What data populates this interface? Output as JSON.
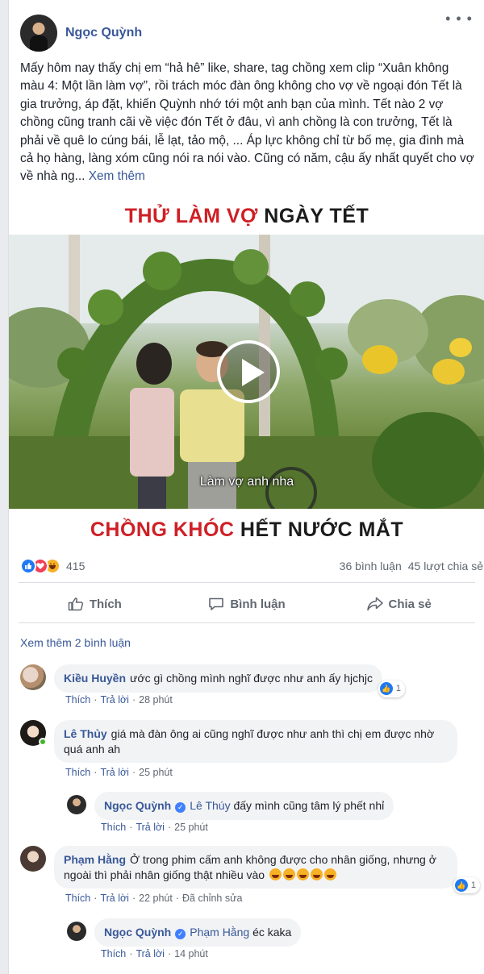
{
  "post": {
    "author": "Ngọc Quỳnh",
    "text": "Mấy hôm nay thấy chị em “hả hê” like, share, tag chồng xem clip “Xuân không màu 4: Một lần làm vợ”, rồi trách móc đàn ông không cho vợ về ngoại đón Tết là gia trưởng, áp đặt, khiến Quỳnh nhớ tới một anh bạn của mình. Tết nào 2 vợ chồng cũng tranh cãi về việc đón Tết ở đâu, vì anh chồng là con trưởng, Tết là phải về quê lo cúng bái, lễ lạt, tảo mộ, ... Áp lực không chỉ từ bố mẹ, gia đình mà cả họ hàng, làng xóm cũng nói ra nói vào. Cũng có năm, cậu ấy nhất quyết cho vợ về nhà ng...",
    "see_more": "Xem thêm"
  },
  "video": {
    "title_red": "THỬ LÀM VỢ",
    "title_dark": "NGÀY TẾT",
    "subtitle": "Làm vợ anh nha",
    "bottom_red": "CHỒNG KHÓC",
    "bottom_dark": "HẾT NƯỚC MẮT"
  },
  "stats": {
    "reactions": "415",
    "comments": "36 bình luận",
    "shares": "45 lượt chia sẻ"
  },
  "actions": {
    "like": "Thích",
    "comment": "Bình luận",
    "share": "Chia sẻ"
  },
  "view_more_comments": "Xem thêm 2 bình luận",
  "meta_labels": {
    "like": "Thích",
    "reply": "Trả lời",
    "edited": "Đã chỉnh sửa"
  },
  "comments": [
    {
      "name": "Kiều Huyền",
      "text": "ước gì chồng mình nghĩ được như anh ấy hjchjc",
      "time": "28 phút",
      "likes": "1"
    },
    {
      "name": "Lê Thủy",
      "text": "giá mà đàn ông ai cũng nghĩ được như anh thì chị em được nhờ quá anh ah",
      "time": "25 phút"
    },
    {
      "name": "Ngọc Quỳnh",
      "tag": "Lê Thúy",
      "text": "đấy mình cũng tâm lý phết nhỉ",
      "time": "25 phút"
    },
    {
      "name": "Phạm Hằng",
      "text": "Ở trong phim cấm anh không được cho nhân giống, nhưng ở ngoài thì phải nhân giống thật nhiều vào",
      "time": "22 phút",
      "likes": "1"
    },
    {
      "name": "Ngọc Quỳnh",
      "tag": "Phạm Hằng",
      "text": "éc kaka",
      "time": "14 phút"
    }
  ],
  "colors": {
    "link": "#385898",
    "title_red": "#cf1f25",
    "like_blue": "#2078f4"
  }
}
